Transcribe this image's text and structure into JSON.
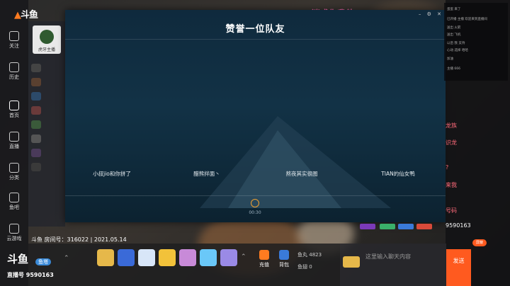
{
  "app": {
    "logo_text": "斗鱼",
    "sidebar": [
      {
        "label": "关注"
      },
      {
        "label": "历史"
      },
      {
        "label": "首页"
      },
      {
        "label": "直播"
      },
      {
        "label": "分类"
      },
      {
        "label": "鱼吧"
      },
      {
        "label": "云游戏"
      }
    ]
  },
  "streamer": {
    "avatar_label": "虎牙主播"
  },
  "overlay": {
    "text": "迷惑你我他"
  },
  "modal": {
    "title": "赞誉一位队友",
    "players": [
      "小叔jio和你拼了",
      "醋熊拌面丶",
      "熬夜其实很图",
      "TIAN的仙女鸭"
    ],
    "timer": "00:30"
  },
  "room": {
    "info": "斗鱼 房间号：316022 | 2021.05.14"
  },
  "bottom": {
    "logo": "斗鱼",
    "sub_label": "直播号",
    "id": "9590163",
    "scene_label": "鱼塔",
    "charge_label": "充值",
    "bag_label": "背包",
    "yuwan_label": "鱼丸",
    "yuwan_value": "4823",
    "yuchi_label": "鱼翅",
    "yuchi_value": "0"
  },
  "chat": {
    "input_placeholder": "这里输入聊天内容",
    "send_label": "发送",
    "fold_label": "屏蔽",
    "right_texts": [
      "龙族",
      "识龙",
      "?",
      "来我",
      "号码",
      "9590163"
    ],
    "lines": [
      "蛋蛋 来了",
      "已开播 主播 欢迎来到直播间",
      "送出 火箭",
      "送出 飞机",
      "以后 我 支持",
      "心动 选择 哈哈",
      "加油",
      "主播 666"
    ]
  },
  "colors": {
    "accent": "#ff5a1f",
    "overlay_pink": "#ff6ab0",
    "modal_bg": "#123246"
  }
}
